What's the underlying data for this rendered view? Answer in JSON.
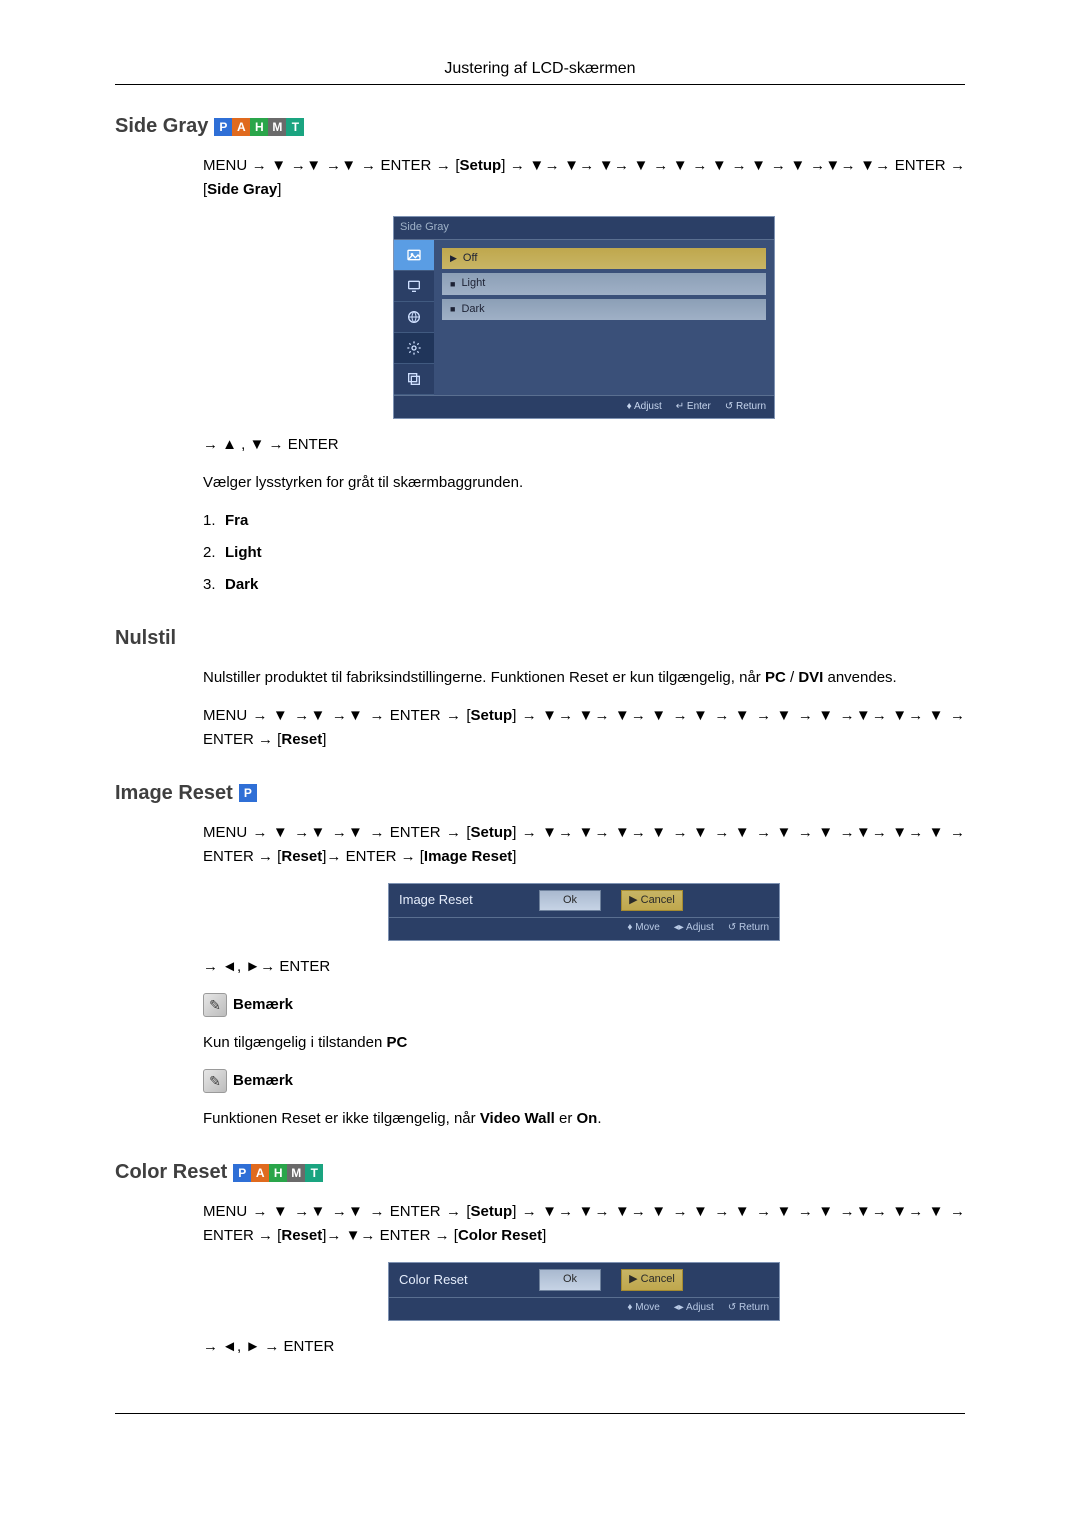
{
  "header": {
    "title": "Justering af LCD-skærmen"
  },
  "badges": {
    "p": "P",
    "a": "A",
    "h": "H",
    "m": "M",
    "t": "T"
  },
  "tokens": {
    "menu": "MENU",
    "enter": "ENTER",
    "setup": "Setup",
    "side_gray": "Side Gray",
    "reset": "Reset",
    "image_reset": "Image Reset",
    "color_reset": "Color Reset",
    "arrow_right": "→",
    "arrow_down": "▼",
    "arrow_up": "▲",
    "arrow_left": "◄",
    "arrow_right_tri": "►",
    "comma": ", "
  },
  "sections": {
    "side_gray": {
      "title": "Side Gray",
      "post_nav": "→ ▲ , ▼ → ENTER",
      "desc": "Vælger lysstyrken for gråt til skærmbaggrunden.",
      "options": {
        "1": "Fra",
        "2": "Light",
        "3": "Dark"
      }
    },
    "nulstil": {
      "title": "Nulstil",
      "desc_pre": "Nulstiller produktet til fabriksindstillingerne. Funktionen Reset er kun tilgængelig, når ",
      "desc_bold1": "PC",
      "desc_mid": " / ",
      "desc_bold2": "DVI",
      "desc_post": " anvendes."
    },
    "image_reset": {
      "title": "Image Reset",
      "post_nav": "→ ◄, ►→ ENTER",
      "note1_label": "Bemærk",
      "note1_text_pre": "Kun tilgængelig i tilstanden ",
      "note1_text_bold": "PC",
      "note2_label": "Bemærk",
      "note2_text_pre": "Funktionen Reset er ikke tilgængelig, når ",
      "note2_bold1": "Video Wall",
      "note2_mid": " er ",
      "note2_bold2": "On",
      "note2_post": "."
    },
    "color_reset": {
      "title": "Color Reset",
      "post_nav": "→ ◄, ► → ENTER"
    }
  },
  "osd_sidegray": {
    "title": "Side Gray",
    "rows": {
      "off": "Off",
      "light": "Light",
      "dark": "Dark"
    },
    "foot": {
      "adjust": "♦ Adjust",
      "enter": "↵ Enter",
      "return": "↺ Return"
    }
  },
  "osd_dialogs": {
    "image_reset": {
      "title": "Image Reset",
      "ok": "Ok",
      "cancel": "Cancel"
    },
    "color_reset": {
      "title": "Color Reset",
      "ok": "Ok",
      "cancel": "Cancel"
    },
    "foot": {
      "move": "♦ Move",
      "adjust": "◂▸ Adjust",
      "return": "↺ Return"
    }
  }
}
